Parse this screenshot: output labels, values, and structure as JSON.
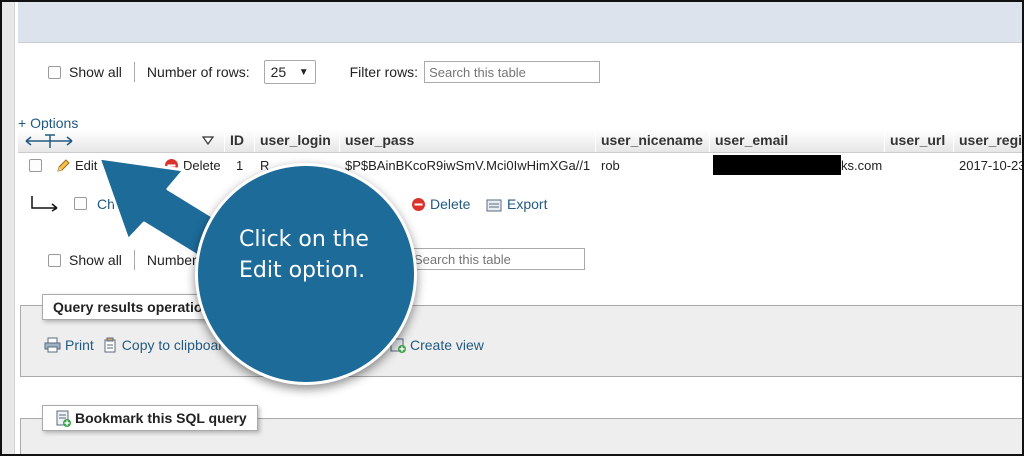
{
  "top_controls": {
    "show_all_label": "Show all",
    "rows_label": "Number of rows:",
    "rows_value": "25",
    "filter_label": "Filter rows:",
    "filter_placeholder": "Search this table"
  },
  "options_link": "+ Options",
  "table": {
    "columns": [
      "ID",
      "user_login",
      "user_pass",
      "user_nicename",
      "user_email",
      "user_url",
      "user_regis"
    ],
    "row": {
      "edit_label": "Edit",
      "delete_label": "Delete",
      "id": "1",
      "user_login": "R",
      "user_pass": "$P$BAinBKcoR9iwSmV.Mci0IwHimXGa//1",
      "user_nicename": "rob",
      "user_email": "ks.com",
      "user_regis": "2017-10-23"
    }
  },
  "bulk_actions": {
    "check_all_label": "Check all",
    "delete_label": "Delete",
    "export_label": "Export"
  },
  "bottom_controls": {
    "show_all_label": "Show all",
    "rows_label": "Number of rows:",
    "filter_placeholder": "Search this table"
  },
  "query_results": {
    "legend": "Query results operations",
    "print_label": "Print",
    "copy_label": "Copy to clipboard",
    "create_view_label": "Create view"
  },
  "bookmark": {
    "legend": "Bookmark this SQL query"
  },
  "callout": {
    "line1": "Click on the",
    "line2": "Edit option."
  },
  "colors": {
    "callout_fill": "#1d6b99",
    "link": "#235a81",
    "delete_icon": "#d9332c"
  }
}
